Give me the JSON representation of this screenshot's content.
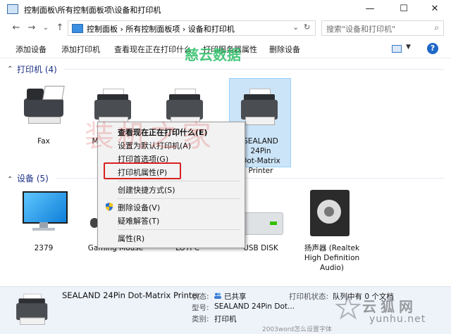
{
  "window": {
    "title": "控制面板\\所有控制面板项\\设备和打印机",
    "minimize": "—",
    "maximize": "☐",
    "close": "✕"
  },
  "address": {
    "back": "←",
    "forward": "→",
    "dropdown": "⌄",
    "up": "↑",
    "breadcrumbs": "控制面板  ›  所有控制面板项  ›  设备和打印机",
    "address_dropdown": "⌄",
    "refresh": "↻",
    "search_placeholder": "搜索\"设备和打印机\"",
    "search_icon": "⌕"
  },
  "commands": {
    "add_device": "添加设备",
    "add_printer": "添加打印机",
    "see_printing": "查看现在正在打印什么",
    "print_server_props": "打印服务器属性",
    "remove_device": "删除设备",
    "help": "?",
    "view_dropdown": "▼"
  },
  "printers": {
    "header": "打印机 (4)",
    "items": [
      {
        "label": "Fax"
      },
      {
        "label": "M"
      },
      {
        "label": ""
      },
      {
        "label": "SEALAND 24Pin Dot-Matrix Printer",
        "line1": "SEALAND 24Pin",
        "line2": "Dot-Matrix",
        "line3": "Printer"
      }
    ]
  },
  "devices": {
    "header": "设备 (5)",
    "items": [
      {
        "label": "2379"
      },
      {
        "label": "Gaming Mouse"
      },
      {
        "label": "LOTPC"
      },
      {
        "label": "USB DISK"
      },
      {
        "label": "扬声器 (Realtek High Definition Audio)",
        "line1": "扬声器 (Realtek",
        "line2": "High Definition",
        "line3": "Audio)"
      }
    ]
  },
  "context_menu": {
    "items": [
      "查看现在正在打印什么(E)",
      "设置为默认打印机(A)",
      "打印首选项(G)",
      "打印机属性(P)",
      "创建快捷方式(S)",
      "删除设备(V)",
      "疑难解答(T)",
      "属性(R)"
    ]
  },
  "status": {
    "name": "SEALAND 24Pin Dot-Matrix Printer",
    "state_label": "状态:",
    "state_value": "已共享",
    "model_label": "型号:",
    "model_value": "SEALAND 24Pin Dot...",
    "category_label": "类别:",
    "category_value": "打印机",
    "printer_status_label": "打印机状态:",
    "printer_status_value": "队列中有 0 个文档"
  },
  "watermarks": {
    "top": "慈云数据",
    "middle": "装机之家",
    "corner": "云狐网",
    "corner_url": "yunhu.net",
    "bottom": "2003word怎么设置字体"
  }
}
